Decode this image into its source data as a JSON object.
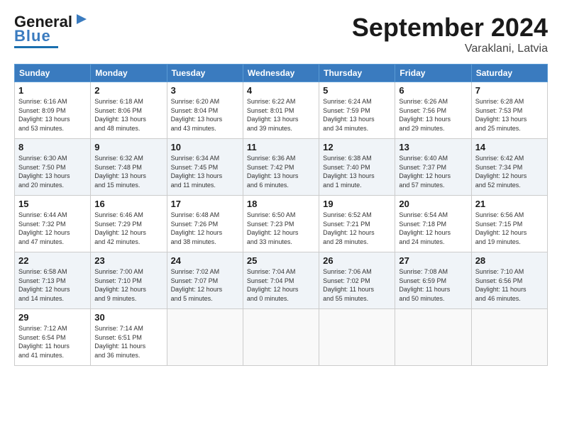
{
  "header": {
    "logo_general": "General",
    "logo_blue": "Blue",
    "title": "September 2024",
    "subtitle": "Varaklani, Latvia"
  },
  "weekdays": [
    "Sunday",
    "Monday",
    "Tuesday",
    "Wednesday",
    "Thursday",
    "Friday",
    "Saturday"
  ],
  "weeks": [
    [
      {
        "day": "1",
        "info": "Sunrise: 6:16 AM\nSunset: 8:09 PM\nDaylight: 13 hours\nand 53 minutes."
      },
      {
        "day": "2",
        "info": "Sunrise: 6:18 AM\nSunset: 8:06 PM\nDaylight: 13 hours\nand 48 minutes."
      },
      {
        "day": "3",
        "info": "Sunrise: 6:20 AM\nSunset: 8:04 PM\nDaylight: 13 hours\nand 43 minutes."
      },
      {
        "day": "4",
        "info": "Sunrise: 6:22 AM\nSunset: 8:01 PM\nDaylight: 13 hours\nand 39 minutes."
      },
      {
        "day": "5",
        "info": "Sunrise: 6:24 AM\nSunset: 7:59 PM\nDaylight: 13 hours\nand 34 minutes."
      },
      {
        "day": "6",
        "info": "Sunrise: 6:26 AM\nSunset: 7:56 PM\nDaylight: 13 hours\nand 29 minutes."
      },
      {
        "day": "7",
        "info": "Sunrise: 6:28 AM\nSunset: 7:53 PM\nDaylight: 13 hours\nand 25 minutes."
      }
    ],
    [
      {
        "day": "8",
        "info": "Sunrise: 6:30 AM\nSunset: 7:50 PM\nDaylight: 13 hours\nand 20 minutes."
      },
      {
        "day": "9",
        "info": "Sunrise: 6:32 AM\nSunset: 7:48 PM\nDaylight: 13 hours\nand 15 minutes."
      },
      {
        "day": "10",
        "info": "Sunrise: 6:34 AM\nSunset: 7:45 PM\nDaylight: 13 hours\nand 11 minutes."
      },
      {
        "day": "11",
        "info": "Sunrise: 6:36 AM\nSunset: 7:42 PM\nDaylight: 13 hours\nand 6 minutes."
      },
      {
        "day": "12",
        "info": "Sunrise: 6:38 AM\nSunset: 7:40 PM\nDaylight: 13 hours\nand 1 minute."
      },
      {
        "day": "13",
        "info": "Sunrise: 6:40 AM\nSunset: 7:37 PM\nDaylight: 12 hours\nand 57 minutes."
      },
      {
        "day": "14",
        "info": "Sunrise: 6:42 AM\nSunset: 7:34 PM\nDaylight: 12 hours\nand 52 minutes."
      }
    ],
    [
      {
        "day": "15",
        "info": "Sunrise: 6:44 AM\nSunset: 7:32 PM\nDaylight: 12 hours\nand 47 minutes."
      },
      {
        "day": "16",
        "info": "Sunrise: 6:46 AM\nSunset: 7:29 PM\nDaylight: 12 hours\nand 42 minutes."
      },
      {
        "day": "17",
        "info": "Sunrise: 6:48 AM\nSunset: 7:26 PM\nDaylight: 12 hours\nand 38 minutes."
      },
      {
        "day": "18",
        "info": "Sunrise: 6:50 AM\nSunset: 7:23 PM\nDaylight: 12 hours\nand 33 minutes."
      },
      {
        "day": "19",
        "info": "Sunrise: 6:52 AM\nSunset: 7:21 PM\nDaylight: 12 hours\nand 28 minutes."
      },
      {
        "day": "20",
        "info": "Sunrise: 6:54 AM\nSunset: 7:18 PM\nDaylight: 12 hours\nand 24 minutes."
      },
      {
        "day": "21",
        "info": "Sunrise: 6:56 AM\nSunset: 7:15 PM\nDaylight: 12 hours\nand 19 minutes."
      }
    ],
    [
      {
        "day": "22",
        "info": "Sunrise: 6:58 AM\nSunset: 7:13 PM\nDaylight: 12 hours\nand 14 minutes."
      },
      {
        "day": "23",
        "info": "Sunrise: 7:00 AM\nSunset: 7:10 PM\nDaylight: 12 hours\nand 9 minutes."
      },
      {
        "day": "24",
        "info": "Sunrise: 7:02 AM\nSunset: 7:07 PM\nDaylight: 12 hours\nand 5 minutes."
      },
      {
        "day": "25",
        "info": "Sunrise: 7:04 AM\nSunset: 7:04 PM\nDaylight: 12 hours\nand 0 minutes."
      },
      {
        "day": "26",
        "info": "Sunrise: 7:06 AM\nSunset: 7:02 PM\nDaylight: 11 hours\nand 55 minutes."
      },
      {
        "day": "27",
        "info": "Sunrise: 7:08 AM\nSunset: 6:59 PM\nDaylight: 11 hours\nand 50 minutes."
      },
      {
        "day": "28",
        "info": "Sunrise: 7:10 AM\nSunset: 6:56 PM\nDaylight: 11 hours\nand 46 minutes."
      }
    ],
    [
      {
        "day": "29",
        "info": "Sunrise: 7:12 AM\nSunset: 6:54 PM\nDaylight: 11 hours\nand 41 minutes."
      },
      {
        "day": "30",
        "info": "Sunrise: 7:14 AM\nSunset: 6:51 PM\nDaylight: 11 hours\nand 36 minutes."
      },
      {
        "day": "",
        "info": ""
      },
      {
        "day": "",
        "info": ""
      },
      {
        "day": "",
        "info": ""
      },
      {
        "day": "",
        "info": ""
      },
      {
        "day": "",
        "info": ""
      }
    ]
  ]
}
